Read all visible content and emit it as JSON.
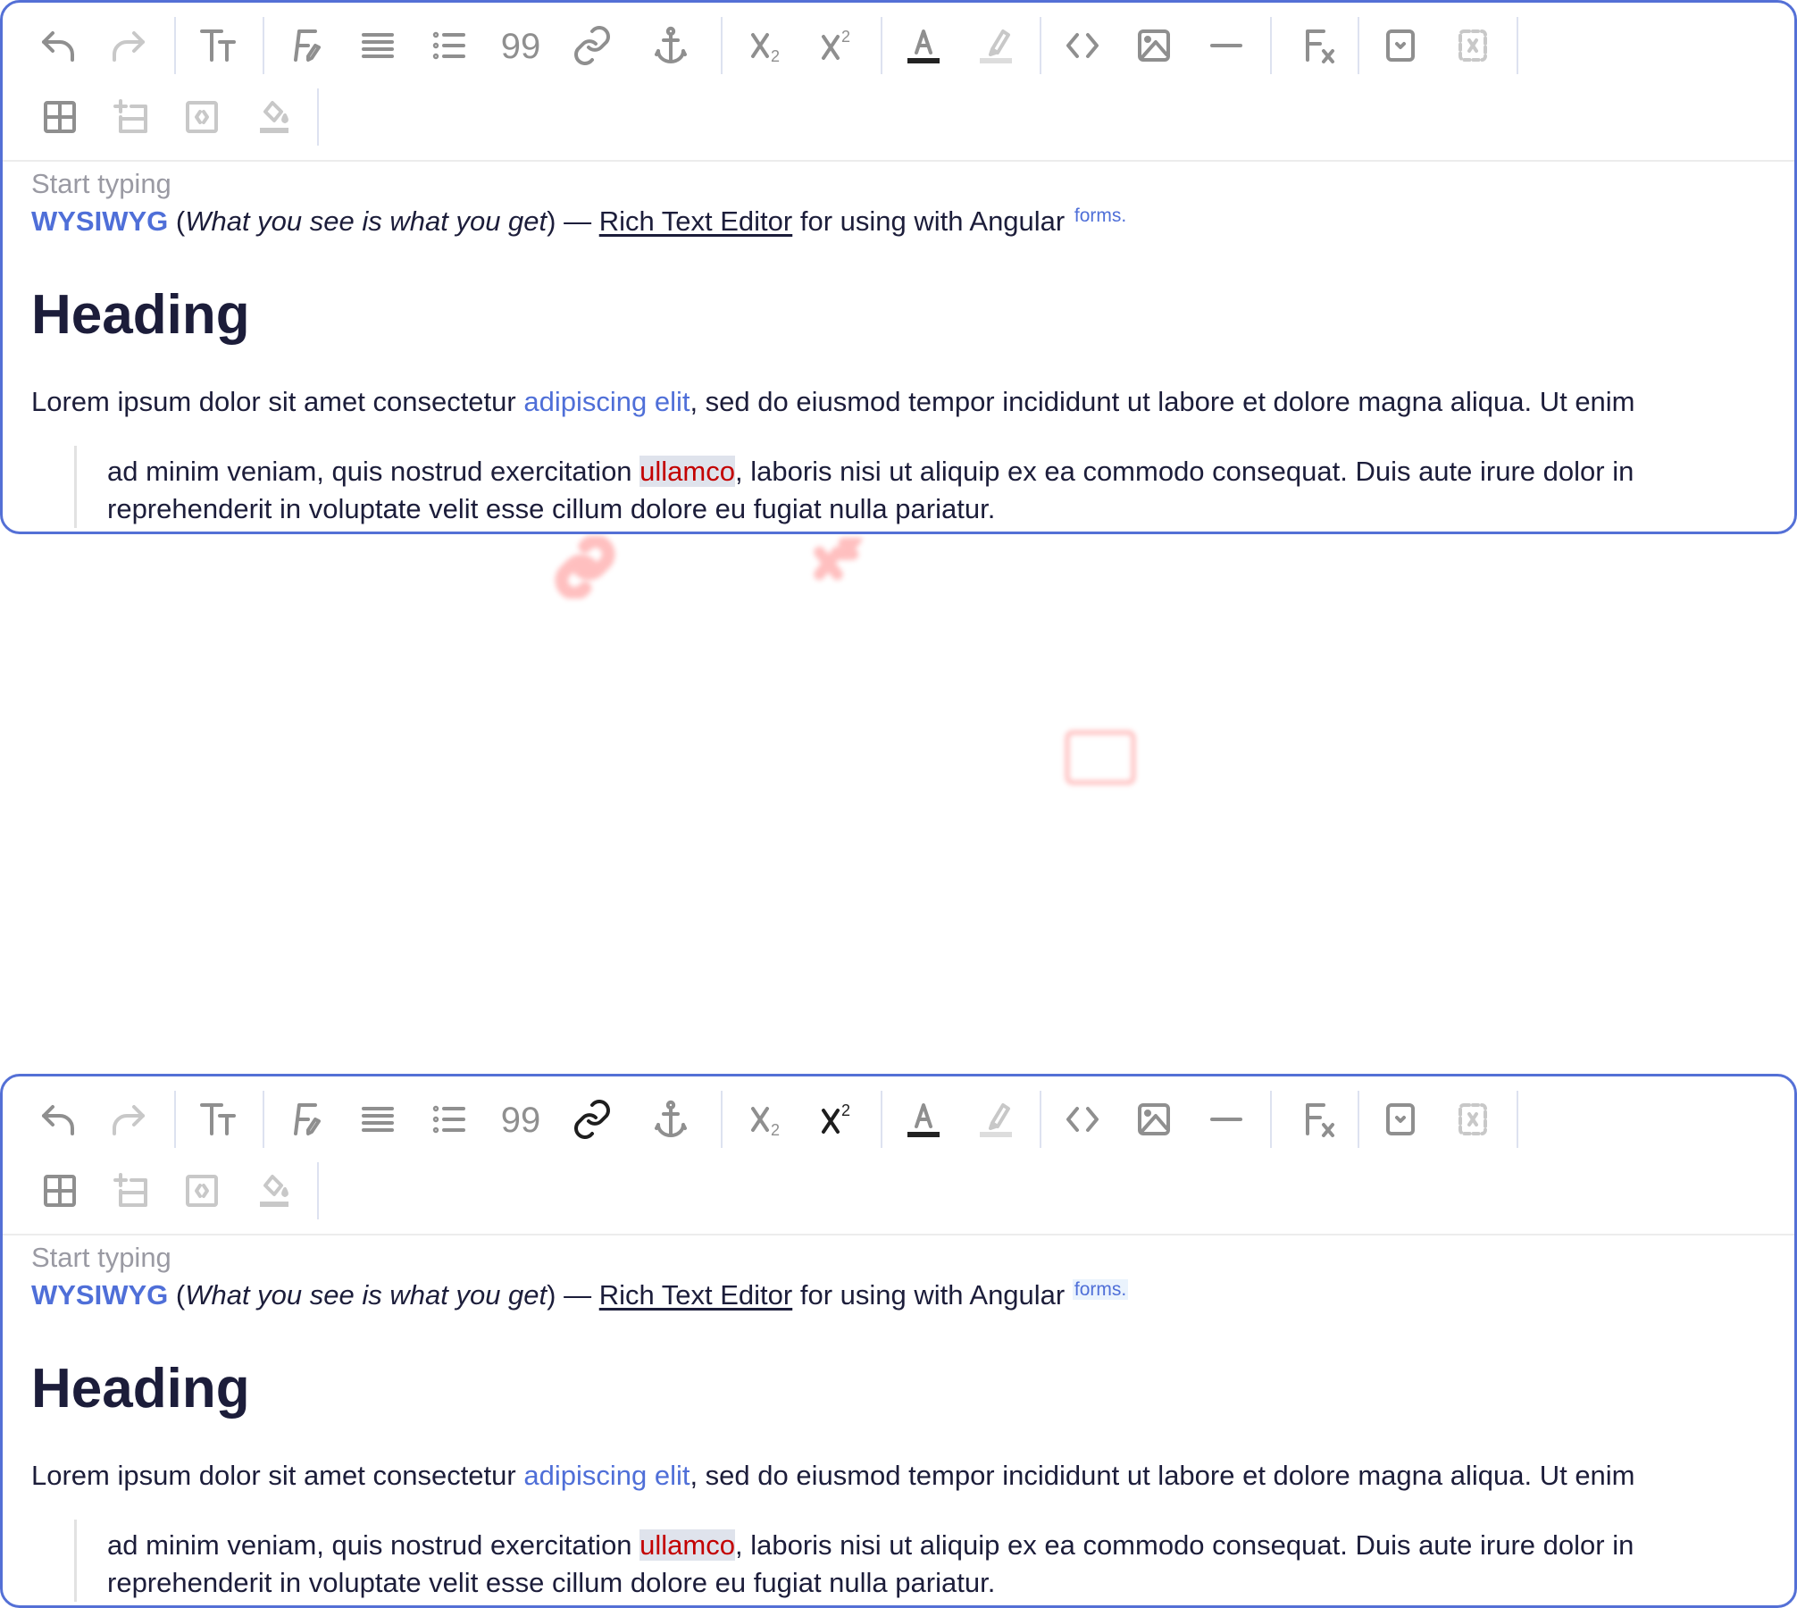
{
  "editors": [
    {
      "toolbar": {
        "quote_glyph": "99",
        "subscript_digit": "2",
        "superscript_digit": "2",
        "active": []
      },
      "placeholder": "Start typing",
      "line1": {
        "strong": "WYSIWYG",
        "open_paren": " (",
        "italic": "What you see is what you get",
        "close_paren_dash": ") — ",
        "underlined": "Rich Text Editor",
        "rest": " for using with Angular ",
        "sup": "forms."
      },
      "heading": "Heading",
      "paragraph": {
        "before": "Lorem ipsum dolor sit amet consectetur ",
        "link": "adipiscing elit",
        "after": ", sed do eiusmod tempor incididunt ut labore et dolore magna aliqua. Ut enim"
      },
      "blockquote": {
        "before": "ad minim veniam, quis nostrud exercitation ",
        "marked": "ullamco",
        "after": ", laboris nisi ut aliquip ex ea commodo consequat. Duis aute irure dolor in reprehenderit in voluptate velit esse cillum dolore eu fugiat nulla pariatur."
      }
    },
    {
      "toolbar": {
        "quote_glyph": "99",
        "subscript_digit": "2",
        "superscript_digit": "2",
        "active": [
          "link",
          "superscript"
        ]
      },
      "placeholder": "Start typing",
      "line1": {
        "strong": "WYSIWYG",
        "open_paren": " (",
        "italic": "What you see is what you get",
        "close_paren_dash": ") — ",
        "underlined": "Rich Text Editor",
        "rest": " for using with Angular ",
        "sup": "forms."
      },
      "heading": "Heading",
      "paragraph": {
        "before": "Lorem ipsum dolor sit amet consectetur ",
        "link": "adipiscing elit",
        "after": ", sed do eiusmod tempor incididunt ut labore et dolore magna aliqua. Ut enim"
      },
      "blockquote": {
        "before": "ad minim veniam, quis nostrud exercitation ",
        "marked": "ullamco",
        "after": ", laboris nisi ut aliquip ex ea commodo consequat. Duis aute irure dolor in reprehenderit in voluptate velit esse cillum dolore eu fugiat nulla pariatur."
      }
    }
  ],
  "colors": {
    "border": "#5470d6",
    "link": "#4f6fd8",
    "mark_text": "#c30000",
    "mark_bg": "#dfe3ec",
    "icon": "#8f8f8f",
    "icon_disabled": "#c8c8c8"
  }
}
